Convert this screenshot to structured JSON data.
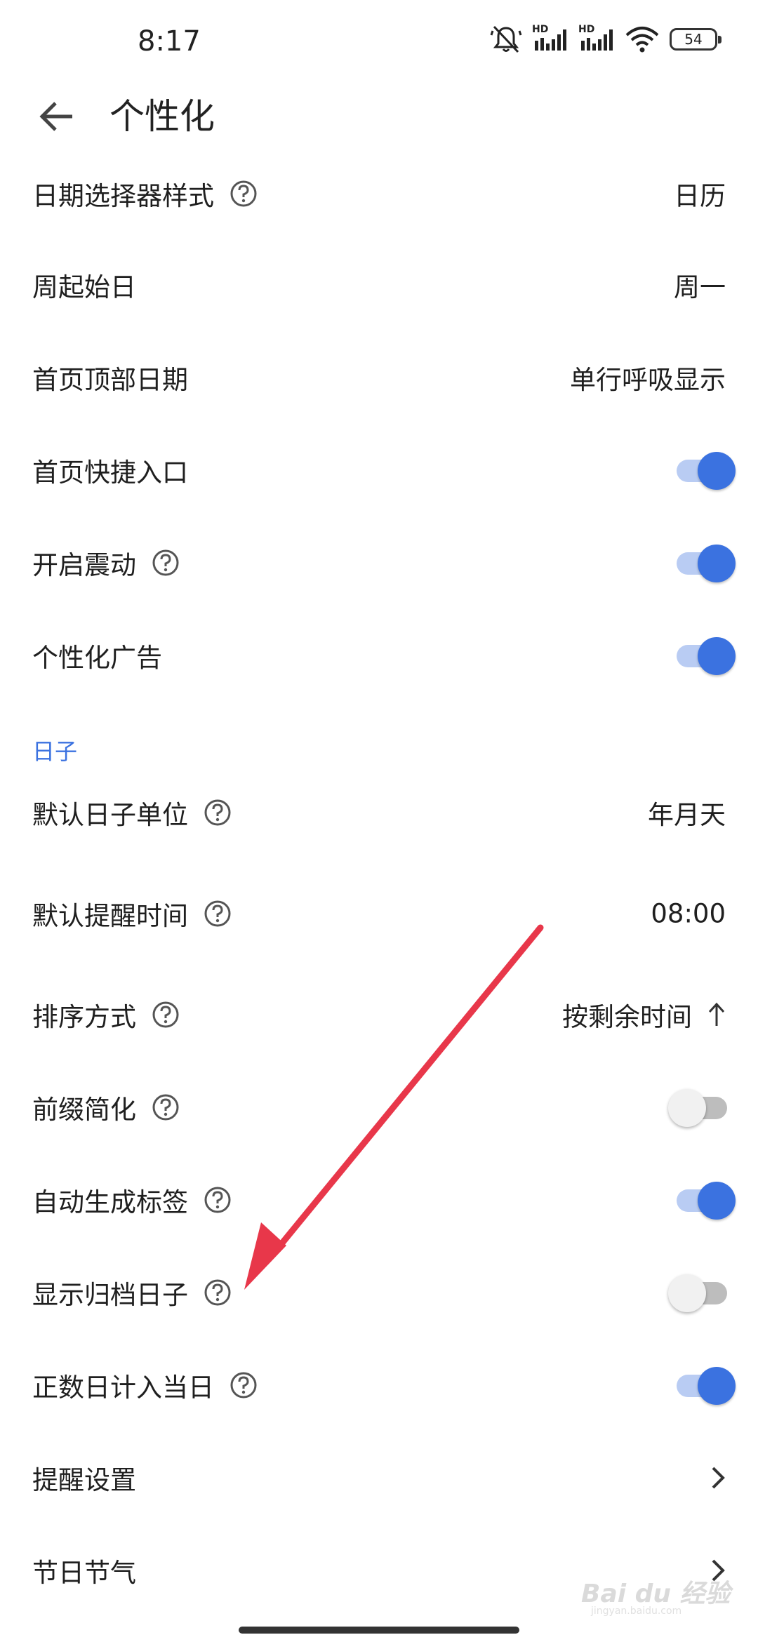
{
  "status_bar": {
    "time": "8:17",
    "hd_label": "HD",
    "battery": "54",
    "icons": [
      "mute-vibrate-icon",
      "signal-hd-icon",
      "signal-hd-icon",
      "wifi-icon",
      "battery-icon"
    ]
  },
  "app_bar": {
    "title": "个性化",
    "back_icon": "arrow-back-icon"
  },
  "rows": [
    {
      "label": "日期选择器样式",
      "help": true,
      "value": "日历"
    },
    {
      "label": "周起始日",
      "help": false,
      "value": "周一"
    },
    {
      "label": "首页顶部日期",
      "help": false,
      "value": "单行呼吸显示"
    },
    {
      "label": "首页快捷入口",
      "help": false,
      "toggle": true
    },
    {
      "label": "开启震动",
      "help": true,
      "toggle": true
    },
    {
      "label": "个性化广告",
      "help": false,
      "toggle": true
    }
  ],
  "section": {
    "title": "日子",
    "rows": [
      {
        "label": "默认日子单位",
        "help": true,
        "value": "年月天"
      },
      {
        "label": "默认提醒时间",
        "help": true,
        "value": "08:00"
      },
      {
        "label": "排序方式",
        "help": true,
        "value": "按剩余时间",
        "value_icon": "arrow-up-icon"
      },
      {
        "label": "前缀简化",
        "help": true,
        "toggle": false
      },
      {
        "label": "自动生成标签",
        "help": true,
        "toggle": true
      },
      {
        "label": "显示归档日子",
        "help": true,
        "toggle": false
      },
      {
        "label": "正数日计入当日",
        "help": true,
        "toggle": true
      },
      {
        "label": "提醒设置",
        "help": false,
        "chevron": true
      },
      {
        "label": "节日节气",
        "help": false,
        "chevron": true
      }
    ]
  },
  "watermark": {
    "text": "Bai du 经验",
    "sub": "jingyan.baidu.com"
  },
  "colors": {
    "accent": "#3b72e0",
    "toggle_track_on": "#b9ccf3",
    "annotation_arrow": "#e8374a"
  }
}
